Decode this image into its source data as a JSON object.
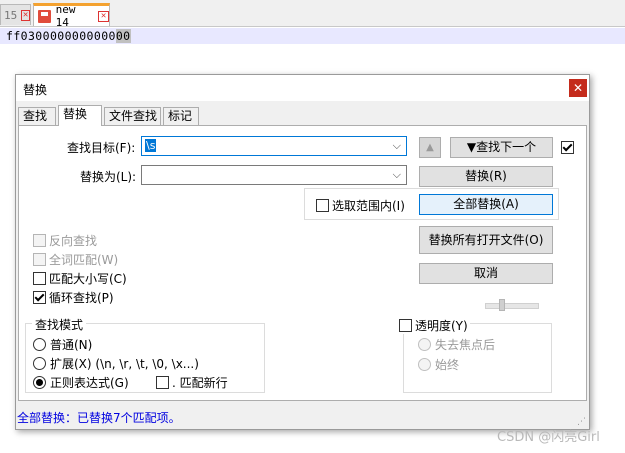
{
  "editor": {
    "tabs": [
      {
        "label": "15"
      },
      {
        "label": "new 14"
      }
    ],
    "line": "ff0300000000000",
    "highlight": "00"
  },
  "dialog": {
    "title": "替换",
    "tabs": [
      "查找",
      "替换",
      "文件查找",
      "标记"
    ],
    "find_label": "查找目标(F):",
    "find_value": "\\s",
    "replace_label": "替换为(L):",
    "replace_value": "",
    "buttons": {
      "up_arrow": "▲",
      "find_next": "▼查找下一个",
      "replace": "替换(R)",
      "replace_all": "全部替换(A)",
      "replace_all_open": "替换所有打开文件(O)",
      "cancel": "取消"
    },
    "in_selection": "选取范围内(I)",
    "options": {
      "backward": "反向查找",
      "whole_word": "全词匹配(W)",
      "match_case": "匹配大小写(C)",
      "wrap": "循环查找(P)"
    },
    "search_mode": {
      "title": "查找模式",
      "normal": "普通(N)",
      "extended": "扩展(X) (\\n, \\r, \\t, \\0, \\x...)",
      "regex": "正则表达式(G)",
      "dot_newline": ". 匹配新行"
    },
    "transparency": {
      "title": "透明度(Y)",
      "on_lose_focus": "失去焦点后",
      "always": "始终"
    },
    "status": "全部替换：已替换7个匹配项。"
  },
  "watermark": "CSDN @闪亮Girl"
}
